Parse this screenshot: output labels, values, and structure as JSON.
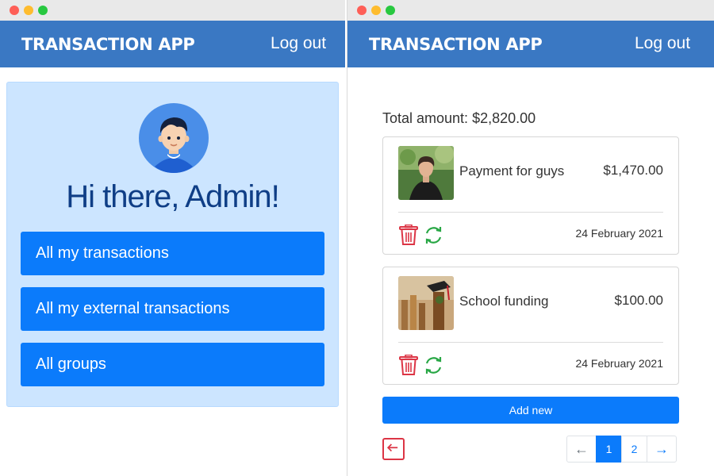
{
  "left_window": {
    "brand": "TRANSACTION APP",
    "logout_label": "Log out",
    "greeting": "Hi there, Admin!",
    "menu": [
      {
        "label": "All my transactions"
      },
      {
        "label": "All my external transactions"
      },
      {
        "label": "All groups"
      }
    ]
  },
  "right_window": {
    "brand": "TRANSACTION APP",
    "logout_label": "Log out",
    "total_label": "Total amount: $2,820.00",
    "transactions": [
      {
        "title": "Payment for guys",
        "amount": "$1,470.00",
        "date": "24 February 2021"
      },
      {
        "title": "School funding",
        "amount": "$100.00",
        "date": "24 February 2021"
      }
    ],
    "add_new_label": "Add new",
    "pagination": {
      "prev": "←",
      "pages": [
        "1",
        "2"
      ],
      "next": "→",
      "active_page": "1"
    }
  },
  "colors": {
    "navbar": "#3a78c3",
    "primary": "#0b7bfb",
    "panel_bg": "#cce5ff",
    "greeting_text": "#0f3e86",
    "danger": "#dc3545",
    "success": "#28a745"
  },
  "icons": [
    "avatar-icon",
    "trash-icon",
    "refresh-icon",
    "arrow-left-icon"
  ]
}
